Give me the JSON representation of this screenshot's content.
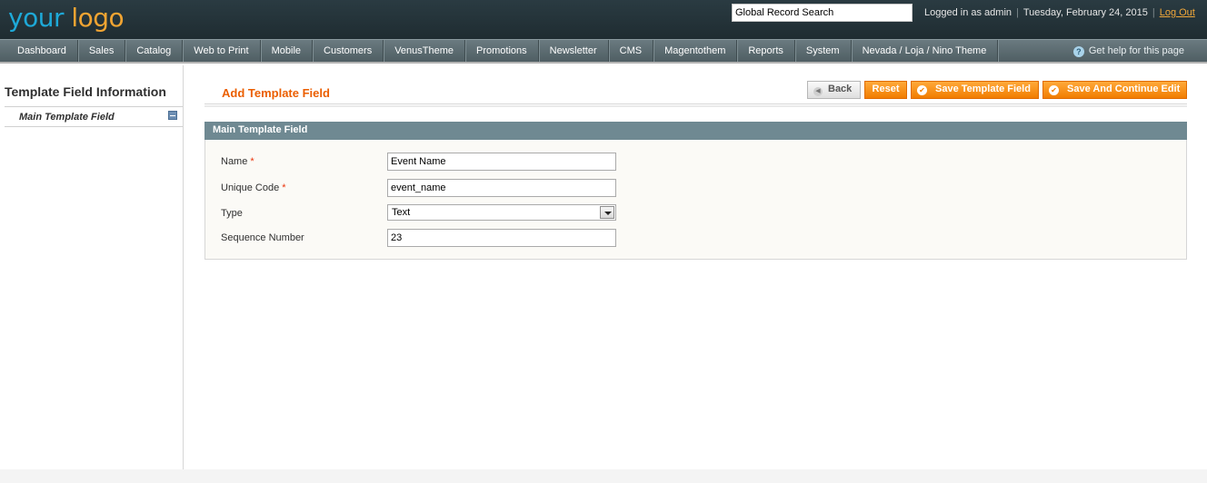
{
  "header": {
    "logo_part1": "your",
    "logo_part2": "logo",
    "search_value": "Global Record Search",
    "logged_in": "Logged in as admin",
    "date": "Tuesday, February 24, 2015",
    "logout": "Log Out"
  },
  "nav": {
    "items": [
      "Dashboard",
      "Sales",
      "Catalog",
      "Web to Print",
      "Mobile",
      "Customers",
      "VenusTheme",
      "Promotions",
      "Newsletter",
      "CMS",
      "Magentothem",
      "Reports",
      "System",
      "Nevada / Loja / Nino Theme"
    ],
    "help": "Get help for this page"
  },
  "sidebar": {
    "title": "Template Field Information",
    "tab": "Main Template Field"
  },
  "main": {
    "title": "Add Template Field",
    "buttons": {
      "back": "Back",
      "reset": "Reset",
      "save": "Save Template Field",
      "save_continue": "Save And Continue Edit"
    },
    "fieldset_title": "Main Template Field",
    "fields": {
      "name_label": "Name",
      "name_value": "Event Name",
      "code_label": "Unique Code",
      "code_value": "event_name",
      "type_label": "Type",
      "type_value": "Text",
      "seq_label": "Sequence Number",
      "seq_value": "23",
      "required_mark": "*"
    }
  },
  "colors": {
    "accent": "#eb5e00",
    "button_orange": "#f17d00",
    "fieldset_header": "#6f8992",
    "header_bg": "#1f2c31"
  }
}
